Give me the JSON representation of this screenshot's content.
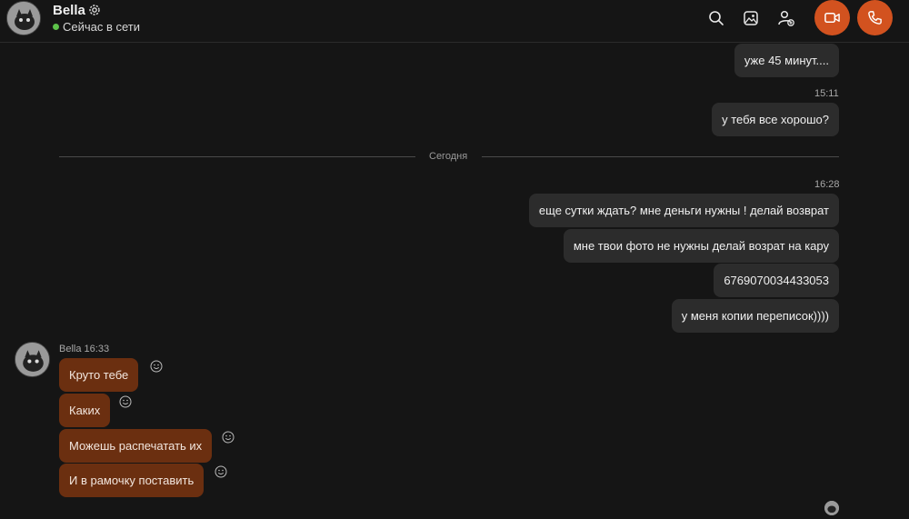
{
  "header": {
    "contact_name": "Bella",
    "status_text": "Сейчас в сети",
    "status_color": "#5dc24a",
    "accent_color": "#d2521f",
    "icons": [
      "gear-icon",
      "search-icon",
      "gallery-icon",
      "add-user-icon",
      "video-call-icon",
      "phone-call-icon"
    ]
  },
  "messages_out_earlier": {
    "msg_1": "уже 45 минут....",
    "time_1": "15:11",
    "msg_2": "у тебя все хорошо?"
  },
  "divider": {
    "label": "Сегодня"
  },
  "messages_out_today": {
    "time": "16:28",
    "items": [
      "еще сутки ждать?  мне деньги нужны ! делай возврат",
      "мне твои фото не нужны делай возрат на кару",
      "6769070034433053",
      "у меня копии переписок))))"
    ]
  },
  "messages_in": {
    "sender": "Bella",
    "time": "16:33",
    "items": [
      "Круто тебе",
      "Каких",
      "Можешь распечатать их",
      "И в рамочку поставить"
    ]
  }
}
